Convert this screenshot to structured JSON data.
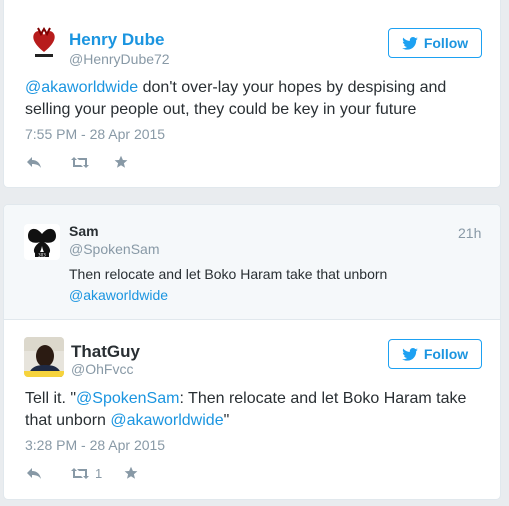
{
  "tweet1": {
    "name": "Henry Dube",
    "handle": "@HenryDube72",
    "follow_label": "Follow",
    "text_mention": "@akaworldwide",
    "text_line1_rest": " don't over-lay your hopes by despising and",
    "text_line2": "selling your people out, they could be key in your future",
    "timestamp": "7:55 PM - 28 Apr 2015"
  },
  "tweet2": {
    "name": "Sam",
    "handle": "@SpokenSam",
    "age": "21h",
    "text_line1": "Then relocate and let Boko Haram take that unborn",
    "text_mention": "@akaworldwide"
  },
  "tweet3": {
    "name": "ThatGuy",
    "handle": "@OhFvcc",
    "follow_label": "Follow",
    "text_line1_prefix": "Tell it. \"",
    "text_line1_mention": "@SpokenSam",
    "text_line1_rest": ": Then relocate and let Boko Haram take",
    "text_line2_prefix": "that unborn ",
    "text_line2_mention": "@akaworldwide",
    "text_line2_suffix": "\"",
    "timestamp": "3:28 PM - 28 Apr 2015",
    "retweet_count": "1"
  },
  "colors": {
    "link": "#1b95e0",
    "muted": "#8899a6",
    "text": "#292f33",
    "background": "#e9ecef"
  }
}
